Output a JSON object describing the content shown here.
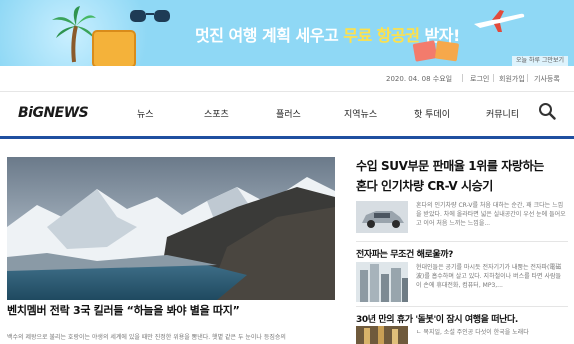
{
  "banner": {
    "headline_pre": "멋진 여행 계획 세우고 ",
    "headline_hl": "무료 항공권",
    "headline_post": " 받자!",
    "badge": "오늘 하루 그만보기"
  },
  "utility": {
    "date": "2020. 04. 08 수요일",
    "login": "로그인",
    "signup": "회원가입",
    "submit": "기사등록"
  },
  "nav": {
    "logo": "BiGNEWS",
    "items": [
      "뉴스",
      "스포츠",
      "플러스",
      "지역뉴스",
      "핫 투데이",
      "커뮤니티"
    ]
  },
  "hero": {
    "caption": "벤치멤버 전락 3국 킬러들 “하늘을 봐야 별을 따지”",
    "desc": "백수의 제왕으로 불리는 호랑이는 야생의 세계에 있을 때만 진정한 위용을 뽐낸다. 햇볕 같은 두 눈이나 등짐승의"
  },
  "side": [
    {
      "title_line1": "수입 SUV부문 판매율 1위를 자랑하는",
      "title_line2": "혼다 인기차량 CR-V 시승기",
      "text": "혼다의 인기차량 CR-V를 처음 대하는 순간, 꽤 크다는 느낌을 받았다. 차에 올라타면 넓은 실내공간이 우선 눈에 들어오고 이어 처음 느끼는 느낌을..."
    },
    {
      "title": "전자파는 무조건 해로울까?",
      "text": "현대인들은 공기를 마시듯 전자기기가 내뿜는 전자파(電磁波)를 흡수하며 살고 있다. 지하철이나 버스를 타면 사람들이 손에 휴대전화, 컴퓨터, MP3,..."
    },
    {
      "title": "30년 만의 휴가 '돌봇'이 잠시 여행을 떠난다.",
      "text": "ㄴ 복지일, 소설 주인공 다섯이 한국을 노래다"
    }
  ],
  "colors": {
    "banner_bg": "#8fd8f5",
    "nav_underline": "#1f4fa0",
    "highlight": "#ffe14a"
  }
}
